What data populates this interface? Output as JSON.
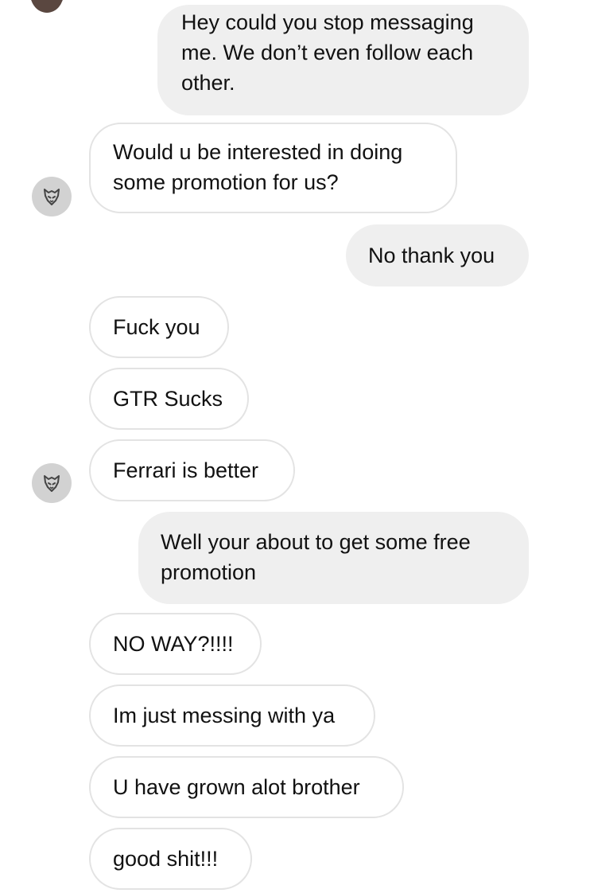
{
  "conversation": {
    "messages": [
      {
        "sender": "me",
        "text": "Hey could you stop messaging me. We don’t even follow each other."
      },
      {
        "sender": "them",
        "text": "Would u be interested in doing some promotion for us?"
      },
      {
        "sender": "me",
        "text": "No thank you"
      },
      {
        "sender": "them",
        "text": "Fuck you"
      },
      {
        "sender": "them",
        "text": "GTR Sucks"
      },
      {
        "sender": "them",
        "text": "Ferrari is better"
      },
      {
        "sender": "me",
        "text": "Well your about to get some free promotion"
      },
      {
        "sender": "them",
        "text": "NO WAY?!!!!"
      },
      {
        "sender": "them",
        "text": "Im just messing with ya"
      },
      {
        "sender": "them",
        "text": "U have grown alot brother"
      },
      {
        "sender": "them",
        "text": "good shit!!!"
      }
    ],
    "incoming_avatar_icon": "wolf-logo-icon",
    "colors": {
      "outgoing_bubble": "#efefef",
      "incoming_border": "#e3e3e3",
      "avatar_bg": "#d2d2d2"
    }
  }
}
